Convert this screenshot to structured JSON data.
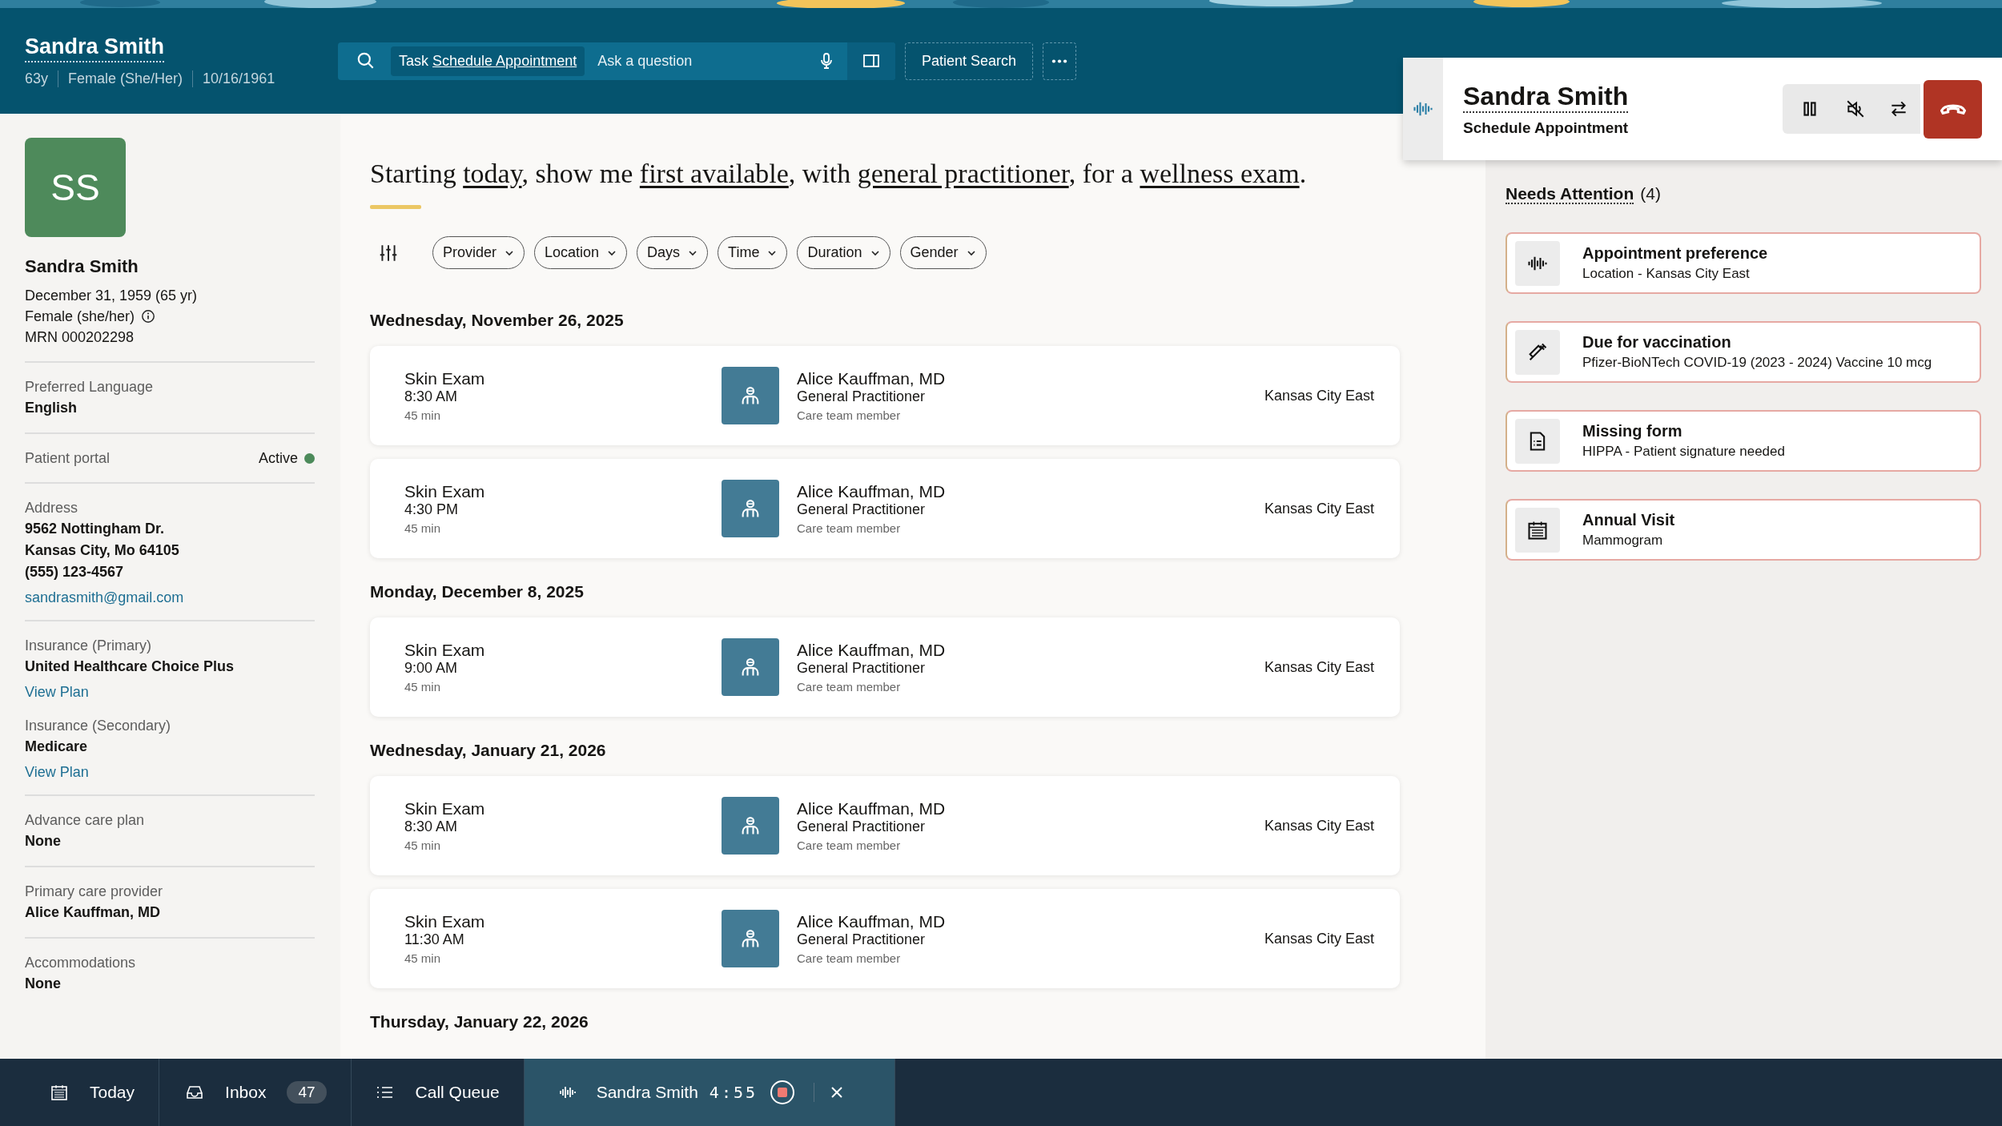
{
  "header": {
    "name": "Sandra Smith",
    "details": [
      "63y",
      "Female (She/Her)",
      "10/16/1961"
    ],
    "search": {
      "task_label": "Task",
      "task": "Schedule Appointment",
      "placeholder": "Ask a question"
    },
    "patient_search": "Patient Search"
  },
  "patient": {
    "initials": "SS",
    "name": "Sandra Smith",
    "lines": [
      "December 31, 1959 (65 yr)",
      "Female (she/her)",
      "MRN 000202298"
    ],
    "groups": [
      {
        "items": [
          {
            "kind": "field",
            "label": "Preferred Language",
            "values": [
              "English"
            ]
          }
        ]
      },
      {
        "items": [
          {
            "kind": "status",
            "label": "Patient portal",
            "values": [
              "Active"
            ],
            "color": "#4c8a5a"
          }
        ]
      },
      {
        "items": [
          {
            "kind": "field",
            "label": "Address",
            "values": [
              "9562 Nottingham Dr.",
              "Kansas City, Mo 64105",
              "(555) 123-4567"
            ],
            "link": "sandrasmith@gmail.com"
          }
        ]
      },
      {
        "items": [
          {
            "kind": "field",
            "label": "Insurance (Primary)",
            "values": [
              "United Healthcare Choice Plus"
            ],
            "link": "View Plan"
          },
          {
            "kind": "field",
            "label": "Insurance (Secondary)",
            "values": [
              "Medicare"
            ],
            "link": "View Plan"
          }
        ]
      },
      {
        "items": [
          {
            "kind": "field",
            "label": "Advance care plan",
            "values": [
              "None"
            ]
          }
        ]
      },
      {
        "items": [
          {
            "kind": "field",
            "label": "Primary care provider",
            "values": [
              "Alice Kauffman, MD"
            ]
          }
        ]
      },
      {
        "items": [
          {
            "kind": "field",
            "label": "Accommodations",
            "values": [
              "None"
            ]
          }
        ]
      }
    ]
  },
  "query": [
    {
      "kind": "plain",
      "text": "Starting "
    },
    {
      "kind": "link",
      "text": "today"
    },
    {
      "kind": "plain",
      "text": ", show me "
    },
    {
      "kind": "link",
      "text": "first available"
    },
    {
      "kind": "plain",
      "text": ", with "
    },
    {
      "kind": "link",
      "text": "general practitioner"
    },
    {
      "kind": "plain",
      "text": ", for a "
    },
    {
      "kind": "link",
      "text": "wellness exam"
    },
    {
      "kind": "plain",
      "text": "."
    }
  ],
  "filters": [
    "Provider",
    "Location",
    "Days",
    "Time",
    "Duration",
    "Gender"
  ],
  "days": [
    {
      "date": "Wednesday, November 26, 2025",
      "slots": [
        {
          "service": "Skin Exam",
          "time": "8:30 AM",
          "duration": "45 min",
          "provider": "Alice Kauffman, MD",
          "specialty": "General Practitioner",
          "role": "Care team member",
          "location": "Kansas City East"
        },
        {
          "service": "Skin Exam",
          "time": "4:30 PM",
          "duration": "45 min",
          "provider": "Alice Kauffman, MD",
          "specialty": "General Practitioner",
          "role": "Care team member",
          "location": "Kansas City East"
        }
      ]
    },
    {
      "date": "Monday, December 8, 2025",
      "slots": [
        {
          "service": "Skin Exam",
          "time": "9:00 AM",
          "duration": "45 min",
          "provider": "Alice Kauffman, MD",
          "specialty": "General Practitioner",
          "role": "Care team member",
          "location": "Kansas City East"
        }
      ]
    },
    {
      "date": "Wednesday, January 21, 2026",
      "slots": [
        {
          "service": "Skin Exam",
          "time": "8:30 AM",
          "duration": "45 min",
          "provider": "Alice Kauffman, MD",
          "specialty": "General Practitioner",
          "role": "Care team member",
          "location": "Kansas City East"
        },
        {
          "service": "Skin Exam",
          "time": "11:30 AM",
          "duration": "45 min",
          "provider": "Alice Kauffman, MD",
          "specialty": "General Practitioner",
          "role": "Care team member",
          "location": "Kansas City East"
        }
      ]
    },
    {
      "date": "Thursday, January 22, 2026"
    }
  ],
  "call": {
    "name": "Sandra Smith",
    "task": "Schedule Appointment"
  },
  "attention": {
    "title": "Needs Attention",
    "count": "(4)",
    "items": [
      {
        "kind": "voice",
        "title": "Appointment preference",
        "detail": "Location - Kansas City East"
      },
      {
        "kind": "vaccine",
        "title": "Due for vaccination",
        "detail": "Pfizer-BioNTech COVID-19 (2023 - 2024) Vaccine 10 mcg"
      },
      {
        "kind": "form",
        "title": "Missing form",
        "detail": "HIPPA - Patient signature needed"
      },
      {
        "kind": "calendar",
        "title": "Annual Visit",
        "detail": "Mammogram"
      }
    ]
  },
  "taskbar": [
    {
      "kind": "today",
      "label": "Today",
      "selected": false
    },
    {
      "kind": "inbox",
      "label": "Inbox",
      "badge": "47",
      "selected": false
    },
    {
      "kind": "queue",
      "label": "Call Queue",
      "selected": false
    },
    {
      "kind": "call",
      "label": "Sandra Smith",
      "timer": "4:55",
      "selected": true
    }
  ]
}
